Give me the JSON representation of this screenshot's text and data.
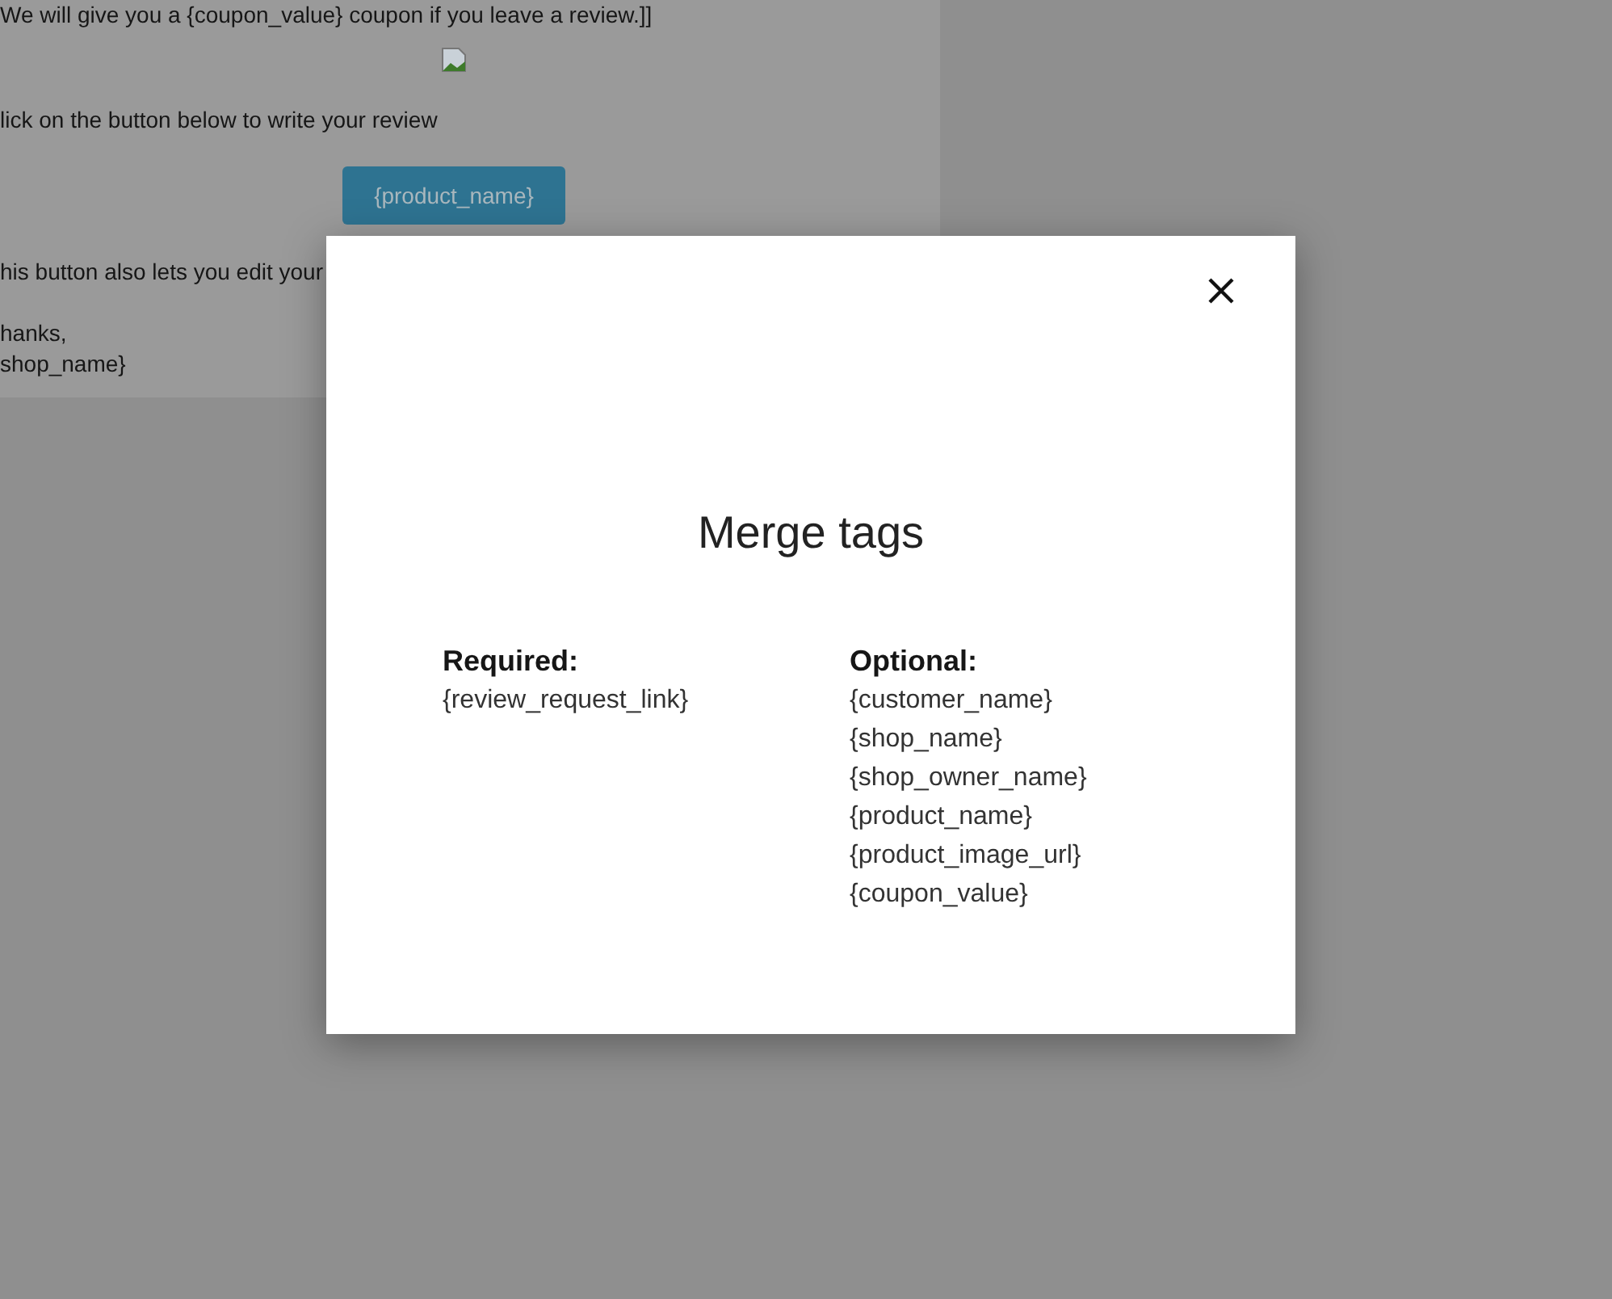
{
  "email_preview": {
    "intro": "We will give you a {coupon_value} coupon if you leave a review.]]",
    "instruction": "lick on the button below to write your review",
    "button": "{product_name}",
    "note": "his button also lets you edit your",
    "signoff": [
      "hanks,",
      "shop_name}"
    ]
  },
  "dialog": {
    "title": "Merge tags",
    "columns": [
      {
        "heading": "Required:",
        "tags": [
          "{review_request_link}"
        ]
      },
      {
        "heading": "Optional:",
        "tags": [
          "{customer_name}",
          "{shop_name}",
          "{shop_owner_name}",
          "{product_name}",
          "{product_image_url}",
          "{coupon_value}"
        ]
      }
    ]
  }
}
